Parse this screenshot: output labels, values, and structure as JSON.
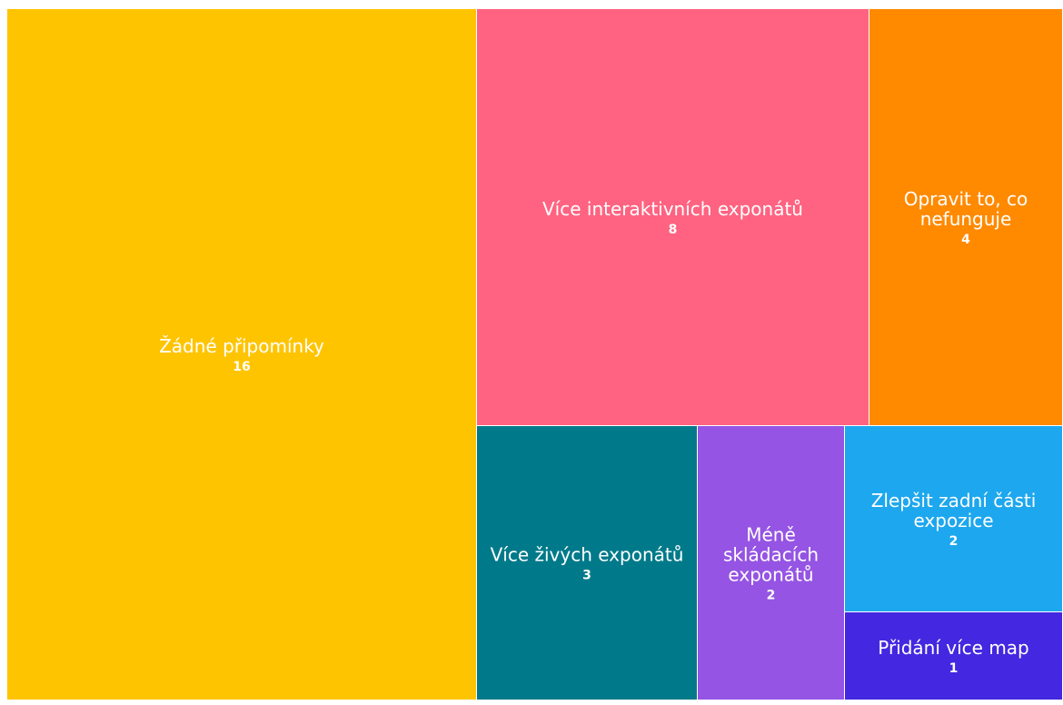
{
  "chart_data": {
    "type": "treemap",
    "title": "",
    "items": [
      {
        "label": "Žádné připomínky",
        "value": 16,
        "color": "#FFC400"
      },
      {
        "label": "Více interaktivních exponátů",
        "value": 8,
        "color": "#FF6381"
      },
      {
        "label": "Opravit to, co nefunguje",
        "value": 4,
        "color": "#FF8A00"
      },
      {
        "label": "Více živých exponátů",
        "value": 3,
        "color": "#007A8A"
      },
      {
        "label": "Méně skládacích exponátů",
        "value": 2,
        "color": "#9554E3"
      },
      {
        "label": "Zlepšit zadní části expozice",
        "value": 2,
        "color": "#1DA7EE"
      },
      {
        "label": "Přidání více map",
        "value": 1,
        "color": "#4427E0"
      }
    ]
  }
}
